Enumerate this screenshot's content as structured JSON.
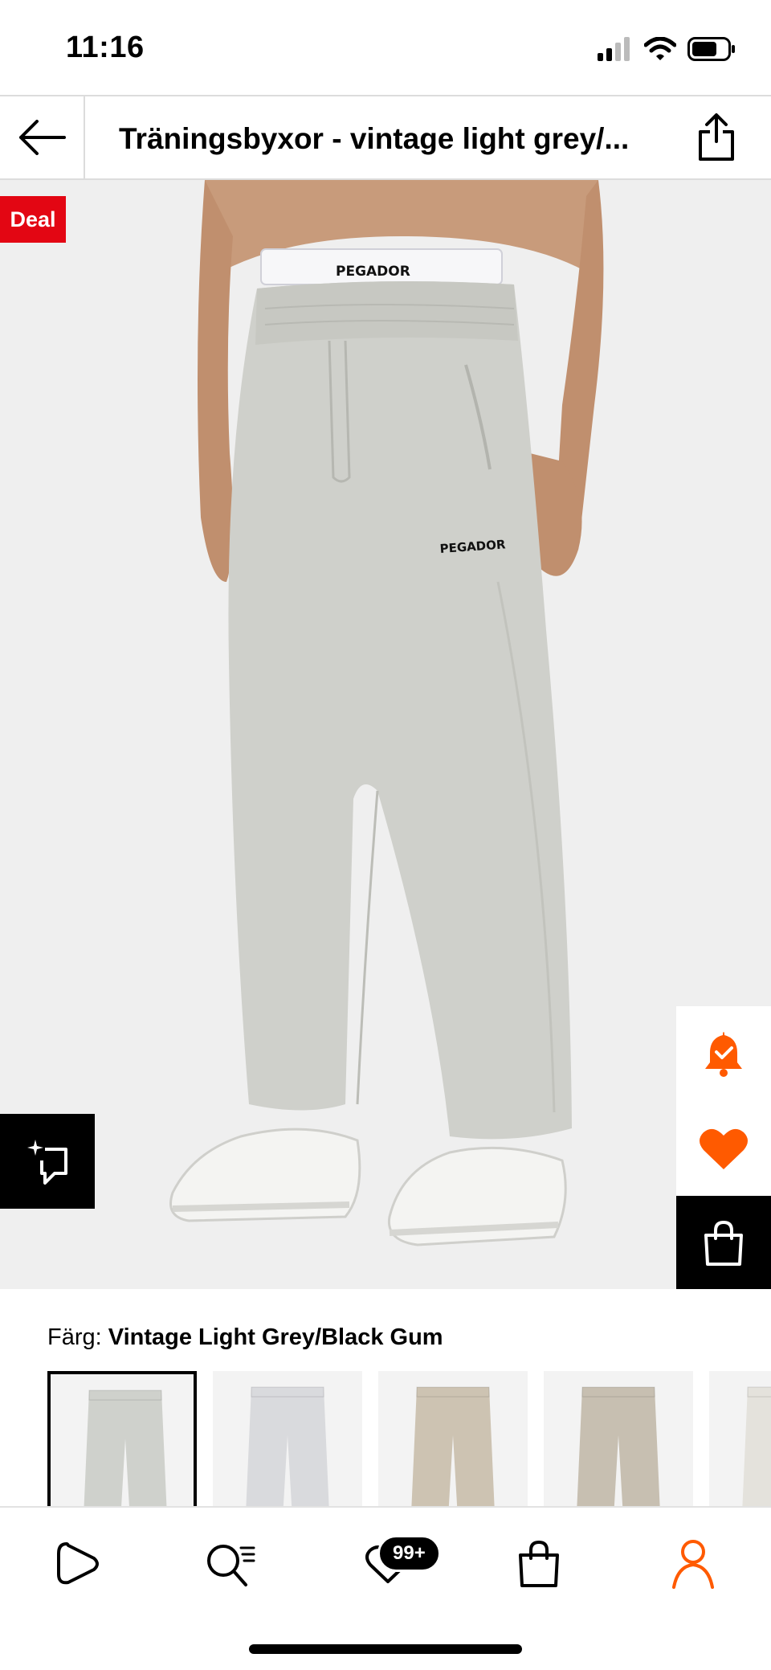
{
  "status_bar": {
    "time": "11:16"
  },
  "header": {
    "title": "Träningsbyxor - vintage light grey/...",
    "back_icon": "arrow-left-icon",
    "share_icon": "share-icon"
  },
  "product": {
    "deal_badge": "Deal",
    "image_description_icon": "product-photo",
    "brand_on_waistband": "PEGADOR",
    "brand_on_pants": "PEGADOR",
    "gallery_progress": 0.125
  },
  "side_actions": {
    "notify_icon": "bell-check-icon",
    "favorite_icon": "heart-icon",
    "bag_icon": "shopping-bag-icon",
    "similar_icon": "sparkle-search-icon"
  },
  "color": {
    "label": "Färg:",
    "value": "Vintage Light Grey/Black Gum",
    "swatches": [
      {
        "name": "Vintage Light Grey/Black Gum",
        "fill": "#cfd1cc",
        "selected": true
      },
      {
        "name": "light grey",
        "fill": "#d9dadd",
        "selected": false
      },
      {
        "name": "beige",
        "fill": "#cdc3b2",
        "selected": false
      },
      {
        "name": "sand",
        "fill": "#c7bfb1",
        "selected": false
      },
      {
        "name": "light",
        "fill": "#e4e2dc",
        "selected": false
      }
    ]
  },
  "bottom_nav": {
    "items": [
      {
        "name": "home",
        "icon": "play-icon"
      },
      {
        "name": "search",
        "icon": "search-icon"
      },
      {
        "name": "favorites",
        "icon": "heart-icon",
        "badge": "99+"
      },
      {
        "name": "bag",
        "icon": "shopping-bag-icon"
      },
      {
        "name": "profile",
        "icon": "user-icon"
      }
    ]
  },
  "colors": {
    "accent": "#ff5a00",
    "deal": "#e30613",
    "black": "#000000"
  }
}
